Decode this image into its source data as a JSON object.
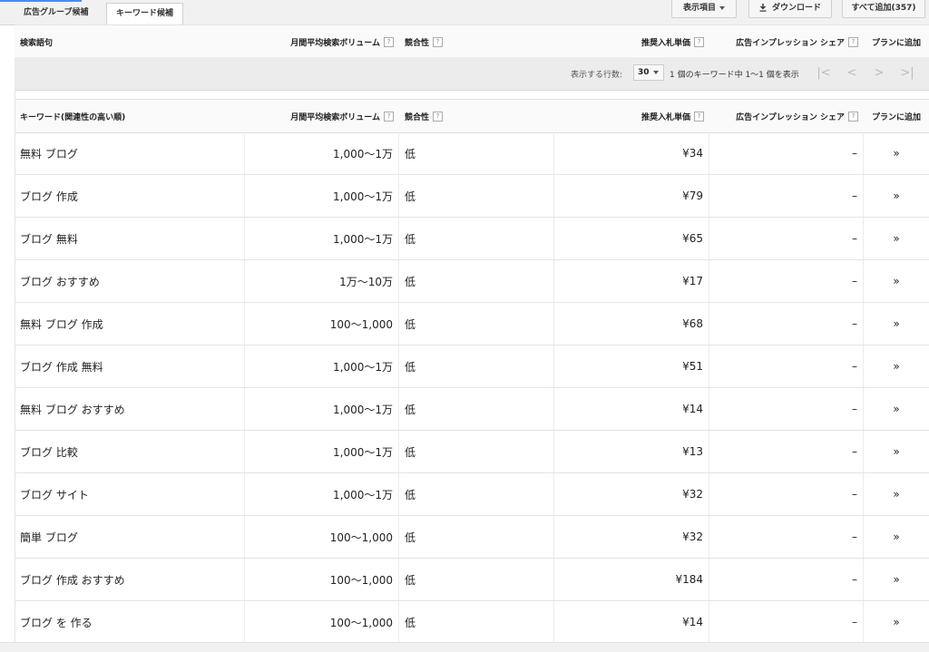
{
  "tabs": [
    {
      "label": "広告グループ候補"
    },
    {
      "label": "キーワード候補"
    }
  ],
  "toolbar": {
    "columns_label": "表示項目",
    "download_label": "ダウンロード",
    "add_all_label": "すべて追加(357)"
  },
  "search_terms_header": {
    "keyword": "検索語句",
    "volume": "月間平均検索ボリューム",
    "competition": "競合性",
    "bid": "推奨入札単価",
    "share": "広告インプレッション シェア",
    "add": "プランに追加"
  },
  "pager": {
    "rows_label": "表示する行数:",
    "rows_value": "30",
    "info": "1 個のキーワード中 1〜1 個を表示",
    "first": "|<",
    "prev": "<",
    "next": ">",
    "last": ">|"
  },
  "keywords_header": {
    "keyword": "キーワード(関連性の高い順)",
    "volume": "月間平均検索ボリューム",
    "competition": "競合性",
    "bid": "推奨入札単価",
    "share": "広告インプレッション シェア",
    "add": "プランに追加"
  },
  "help_glyph": "?",
  "add_glyph": "»",
  "rows": [
    {
      "keyword": "無料 ブログ",
      "volume": "1,000〜1万",
      "competition": "低",
      "bid": "¥34",
      "share": "–"
    },
    {
      "keyword": "ブログ 作成",
      "volume": "1,000〜1万",
      "competition": "低",
      "bid": "¥79",
      "share": "–"
    },
    {
      "keyword": "ブログ 無料",
      "volume": "1,000〜1万",
      "competition": "低",
      "bid": "¥65",
      "share": "–"
    },
    {
      "keyword": "ブログ おすすめ",
      "volume": "1万〜10万",
      "competition": "低",
      "bid": "¥17",
      "share": "–"
    },
    {
      "keyword": "無料 ブログ 作成",
      "volume": "100〜1,000",
      "competition": "低",
      "bid": "¥68",
      "share": "–"
    },
    {
      "keyword": "ブログ 作成 無料",
      "volume": "1,000〜1万",
      "competition": "低",
      "bid": "¥51",
      "share": "–"
    },
    {
      "keyword": "無料 ブログ おすすめ",
      "volume": "1,000〜1万",
      "competition": "低",
      "bid": "¥14",
      "share": "–"
    },
    {
      "keyword": "ブログ 比較",
      "volume": "1,000〜1万",
      "competition": "低",
      "bid": "¥13",
      "share": "–"
    },
    {
      "keyword": "ブログ サイト",
      "volume": "1,000〜1万",
      "competition": "低",
      "bid": "¥32",
      "share": "–"
    },
    {
      "keyword": "簡単 ブログ",
      "volume": "100〜1,000",
      "competition": "低",
      "bid": "¥32",
      "share": "–"
    },
    {
      "keyword": "ブログ 作成 おすすめ",
      "volume": "100〜1,000",
      "competition": "低",
      "bid": "¥184",
      "share": "–"
    },
    {
      "keyword": "ブログ を 作る",
      "volume": "100〜1,000",
      "competition": "低",
      "bid": "¥14",
      "share": "–"
    }
  ]
}
